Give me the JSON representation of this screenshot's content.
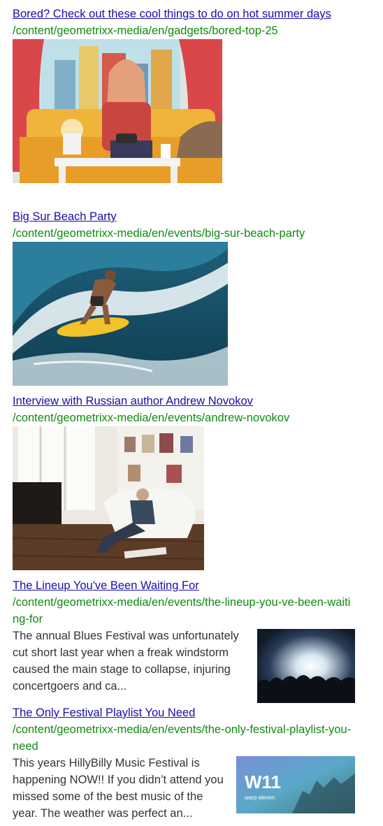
{
  "results": [
    {
      "title": "Bored? Check out these cool things to do on hot summer days",
      "path": "/content/geometrixx-media/en/gadgets/bored-top-25",
      "image_icon": "illustration-girl-gaming-icon"
    },
    {
      "title": "Big Sur Beach Party",
      "path": "/content/geometrixx-media/en/events/big-sur-beach-party",
      "image_icon": "surfer-photo-icon"
    },
    {
      "title": "Interview with Russian author Andrew Novokov",
      "path": "/content/geometrixx-media/en/events/andrew-novokov",
      "image_icon": "author-room-photo-icon"
    },
    {
      "title": "The Lineup You've Been Waiting For",
      "path": "/content/geometrixx-media/en/events/the-lineup-you-ve-been-waiting-for",
      "snippet": "The annual Blues Festival was unfortunately cut short last year when a freak windstorm caused the main stage to collapse, injuring concertgoers and ca...",
      "image_icon": "concert-crowd-photo-icon"
    },
    {
      "title": "The Only Festival Playlist You Need",
      "path": "/content/geometrixx-media/en/events/the-only-festival-playlist-you-need",
      "snippet": "This years HillyBilly Music Festival is happening NOW!! If you didn’t attend you missed some of the best music of the year. The weather was perfect an...",
      "image_icon": "warp-eleven-logo-icon",
      "image_logo_text": "W11",
      "image_caption": "warp eleven"
    }
  ],
  "colors": {
    "link": "#1a0dab",
    "path": "#118a11",
    "text": "#333333"
  }
}
